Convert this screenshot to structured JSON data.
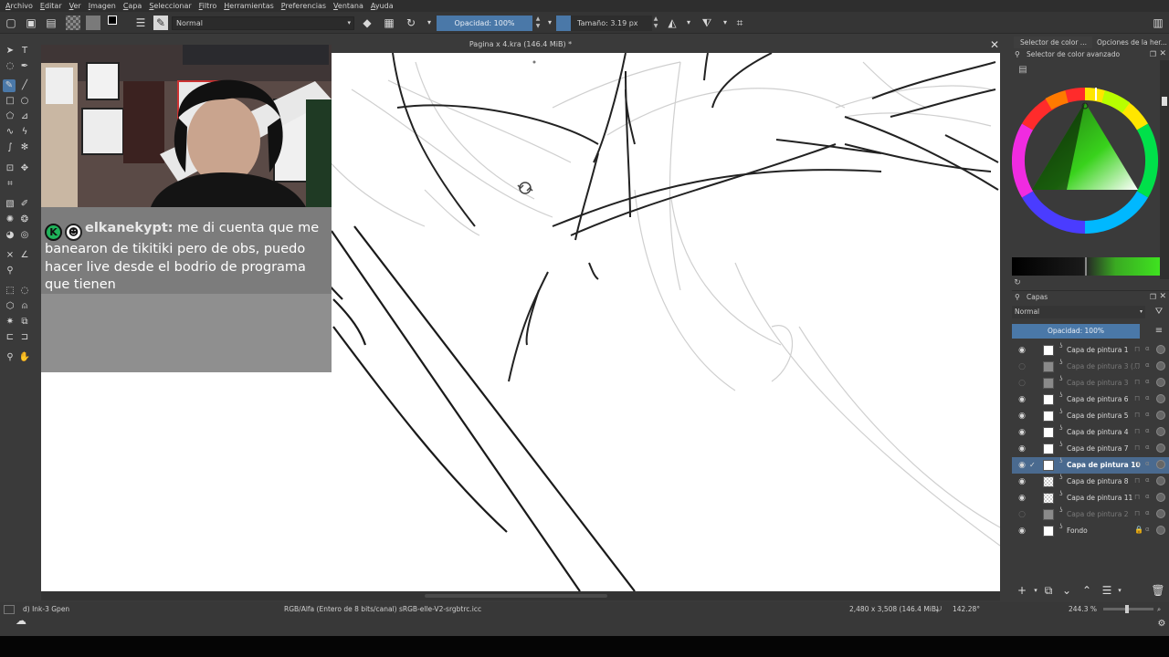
{
  "menu": [
    "Archivo",
    "Editar",
    "Ver",
    "Imagen",
    "Capa",
    "Seleccionar",
    "Filtro",
    "Herramientas",
    "Preferencias",
    "Ventana",
    "Ayuda"
  ],
  "toolbar": {
    "blend_mode": "Normal",
    "opacity_label": "Opacidad: 100%",
    "size_label": "Tamaño: 3.19 px"
  },
  "document": {
    "title": "Pagina x 4.kra (146.4 MiB) *"
  },
  "chat": {
    "username": "elkanekypt:",
    "message": " me di cuenta que me banearon de tikitiki pero de obs, puedo hacer live desde el bodrio de programa que tienen"
  },
  "dockers": {
    "tab_color": "Selector de color ...",
    "tab_tools": "Opciones de la her...",
    "color_panel_title": "Selector de color avanzado",
    "layers_panel_title": "Capas",
    "layers_blend": "Normal",
    "layers_opacity": "Opacidad:  100%"
  },
  "layers": [
    {
      "name": "Capa de pintura 1",
      "visible": true,
      "selected": false
    },
    {
      "name": "Capa de pintura 3 (...",
      "visible": false,
      "selected": false
    },
    {
      "name": "Capa de pintura 3",
      "visible": false,
      "selected": false
    },
    {
      "name": "Capa de pintura 6",
      "visible": true,
      "selected": false
    },
    {
      "name": "Capa de pintura 5",
      "visible": true,
      "selected": false
    },
    {
      "name": "Capa de pintura 4",
      "visible": true,
      "selected": false
    },
    {
      "name": "Capa de pintura 7",
      "visible": true,
      "selected": false
    },
    {
      "name": "Capa de pintura 10",
      "visible": true,
      "selected": true
    },
    {
      "name": "Capa de pintura 8",
      "visible": true,
      "selected": false
    },
    {
      "name": "Capa de pintura 11",
      "visible": true,
      "selected": false
    },
    {
      "name": "Capa de pintura 2",
      "visible": false,
      "selected": false
    },
    {
      "name": "Fondo",
      "visible": true,
      "selected": false
    }
  ],
  "status": {
    "brush": "d) Ink-3 Gpen",
    "color_model": "RGB/Alfa (Entero de 8 bits/canal)  sRGB-elle-V2-srgbtrc.icc",
    "dimensions": "2,480 x 3,508 (146.4 MiB)",
    "rotation": "142.28°",
    "zoom": "244.3 %"
  },
  "colors": {
    "accent": "#4a78a8",
    "panel": "#3a3a3a",
    "selected_layer": "#4a6a8f"
  }
}
